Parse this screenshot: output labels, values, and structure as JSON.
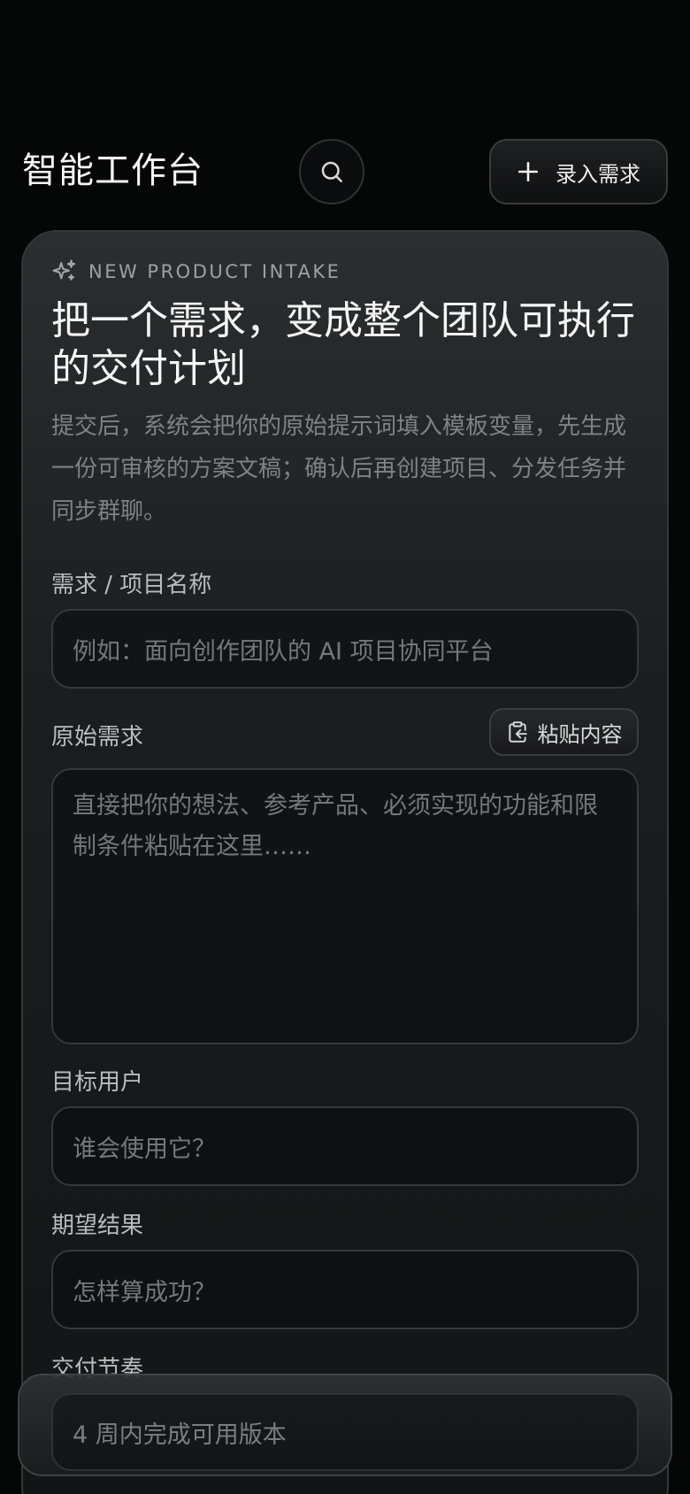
{
  "header": {
    "title": "智能工作台",
    "add_button_label": "录入需求"
  },
  "intake": {
    "eyebrow": "NEW PRODUCT INTAKE",
    "title": "把一个需求，变成整个团队可执行的交付计划",
    "description": "提交后，系统会把你的原始提示词填入模板变量，先生成一份可审核的方案文稿；确认后再创建项目、分发任务并同步群聊。"
  },
  "form": {
    "name_label": "需求 / 项目名称",
    "name_placeholder": "例如：面向创作团队的 AI 项目协同平台",
    "raw_label": "原始需求",
    "paste_label": "粘贴内容",
    "raw_placeholder": "直接把你的想法、参考产品、必须实现的功能和限制条件粘贴在这里……",
    "users_label": "目标用户",
    "users_placeholder": "谁会使用它？",
    "outcome_label": "期望结果",
    "outcome_placeholder": "怎样算成功？",
    "cadence_label": "交付节奏",
    "cadence_placeholder": "4 周内完成可用版本"
  },
  "icons": {
    "search": "search-icon",
    "add": "plus-icon",
    "sparkle": "sparkles-icon",
    "paste": "clipboard-icon"
  }
}
